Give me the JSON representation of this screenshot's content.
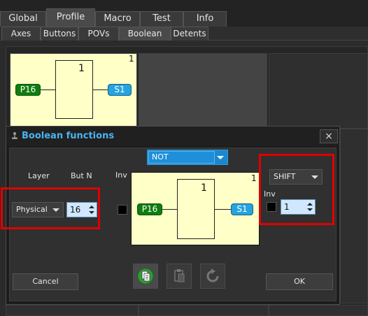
{
  "top_tabs": [
    {
      "label": "Global"
    },
    {
      "label": "Profile"
    },
    {
      "label": "Macro"
    },
    {
      "label": "Test"
    },
    {
      "label": "Info"
    }
  ],
  "sub_tabs": [
    {
      "label": "Axes"
    },
    {
      "label": "Buttons"
    },
    {
      "label": "POVs"
    },
    {
      "label": "Boolean"
    },
    {
      "label": "Detents"
    }
  ],
  "background_block": {
    "corner_number": "1",
    "gate_number": "1",
    "input_label": "P16",
    "output_label": "S1"
  },
  "dialog": {
    "title": "Boolean functions",
    "close_label": "×",
    "layer_label": "Layer",
    "butn_label": "But N",
    "inv_label": "Inv",
    "layer_value": "Physical",
    "butn_value": "16",
    "function_value": "NOT",
    "diagram": {
      "corner_number": "1",
      "gate_number": "1",
      "input_label": "P16",
      "output_label": "S1"
    },
    "shift_value": "SHIFT",
    "shift_inv_label": "Inv",
    "shift_spin_value": "1",
    "cancel_label": "Cancel",
    "ok_label": "OK",
    "icons": [
      "copy-icon",
      "paste-icon",
      "undo-icon"
    ]
  },
  "colors": {
    "accent_blue": "#4ab3f0",
    "input_green": "#0f7d0f",
    "output_blue": "#25a4e0",
    "block_yellow": "#ffffc8",
    "highlight_red": "#e00000"
  }
}
